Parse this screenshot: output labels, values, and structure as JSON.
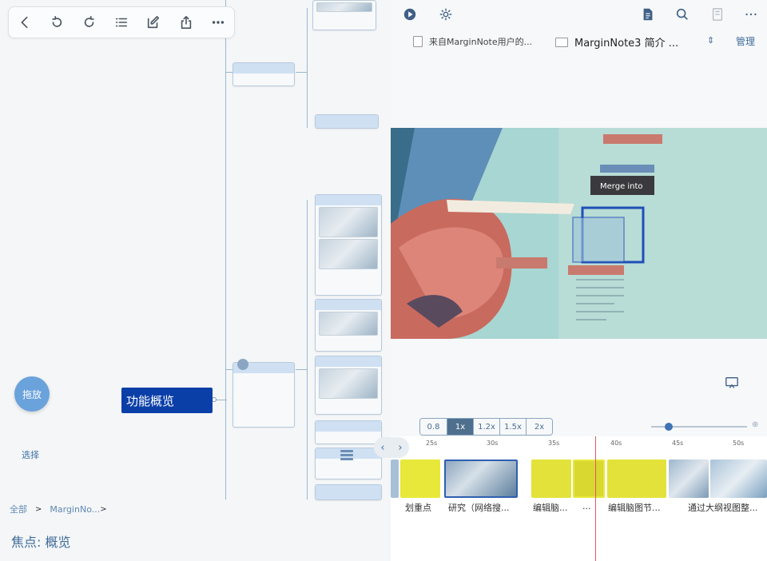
{
  "left": {
    "toolbar": {
      "icons": [
        "back-icon",
        "undo-icon",
        "redo-icon",
        "outline-list-icon",
        "edit-icon",
        "share-icon",
        "more-icon"
      ]
    },
    "root_node": "功能概览",
    "circle_button": "拖放",
    "select_label": "选择",
    "breadcrumb": {
      "all": "全部",
      "sep": ">",
      "item": "MarginNo...",
      "sep2": ">"
    },
    "focus": {
      "label": "焦点:",
      "value": "概览"
    }
  },
  "right": {
    "tabs": {
      "doc1": "来自MarginNote用户的...",
      "doc2": "MarginNote3 简介 ...",
      "manage": "管理"
    },
    "video": {
      "overlay_text": "Merge into"
    },
    "speeds": [
      "0.8",
      "1x",
      "1.2x",
      "1.5x",
      "2x"
    ],
    "active_speed": "1x",
    "timeline": {
      "ticks": [
        "25s",
        "30s",
        "35s",
        "40s",
        "45s",
        "50s"
      ],
      "clips": [
        "划重点",
        "研究（网络搜...",
        "编辑脑...",
        "...",
        "编辑脑图节...",
        "通过大纲视图整..."
      ]
    }
  },
  "colors": {
    "accent": "#0b3fa8",
    "link": "#3d6fa3",
    "highlight": "#e8e83a",
    "speed_active": "#4f6f8e",
    "playhead": "#d85a6a"
  }
}
